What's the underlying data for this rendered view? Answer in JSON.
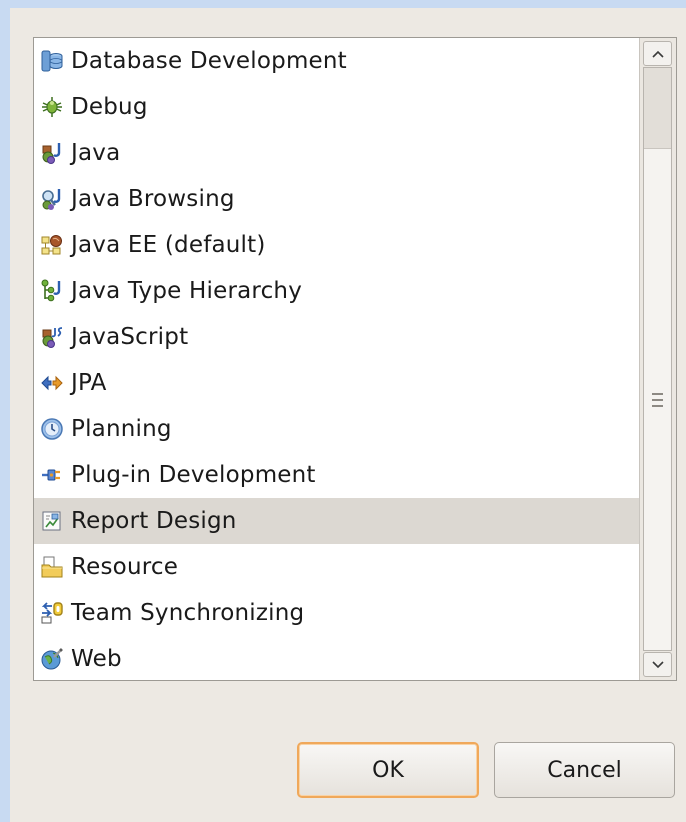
{
  "perspectives": [
    {
      "label": "Database Development",
      "icon": "database-icon",
      "selected": false
    },
    {
      "label": "Debug",
      "icon": "bug-icon",
      "selected": false
    },
    {
      "label": "Java",
      "icon": "java-perspective-icon",
      "selected": false
    },
    {
      "label": "Java Browsing",
      "icon": "java-browsing-icon",
      "selected": false
    },
    {
      "label": "Java EE (default)",
      "icon": "java-ee-icon",
      "selected": false
    },
    {
      "label": "Java Type Hierarchy",
      "icon": "type-hierarchy-icon",
      "selected": false
    },
    {
      "label": "JavaScript",
      "icon": "javascript-icon",
      "selected": false
    },
    {
      "label": "JPA",
      "icon": "jpa-icon",
      "selected": false
    },
    {
      "label": "Planning",
      "icon": "clock-icon",
      "selected": false
    },
    {
      "label": "Plug-in Development",
      "icon": "plugin-icon",
      "selected": false
    },
    {
      "label": "Report Design",
      "icon": "report-design-icon",
      "selected": true
    },
    {
      "label": "Resource",
      "icon": "folder-icon",
      "selected": false
    },
    {
      "label": "Team Synchronizing",
      "icon": "team-sync-icon",
      "selected": false
    },
    {
      "label": "Web",
      "icon": "web-globe-icon",
      "selected": false
    }
  ],
  "buttons": {
    "ok_label": "OK",
    "cancel_label": "Cancel"
  },
  "scrollbar": {
    "position_fraction": 0.0
  },
  "colors": {
    "selection": "#dcd8d2",
    "dialog_bg": "#ede9e3",
    "default_button_border": "#f0a85a"
  }
}
